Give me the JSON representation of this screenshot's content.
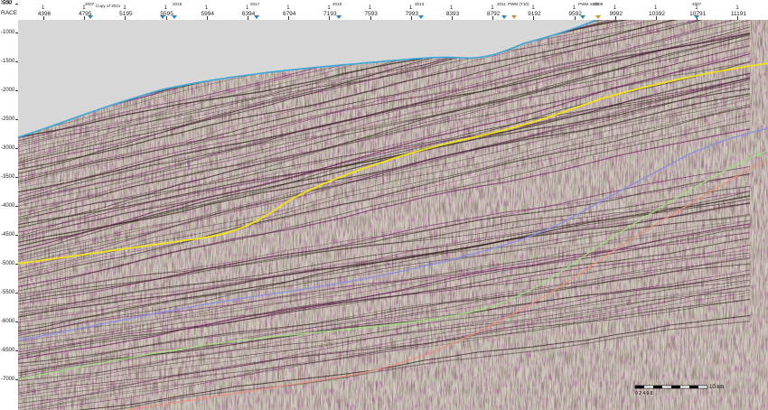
{
  "header": {
    "top_left_label": "SSD",
    "row_label": "RACE",
    "shot_labels": [
      "1",
      "1",
      "1",
      "1",
      "1",
      "1",
      "1",
      "1",
      "1",
      "1",
      "1",
      "1",
      "1",
      "1",
      "1",
      "1",
      "1",
      "1",
      "1"
    ],
    "cdp_numbers": [
      "4396",
      "4795",
      "5195",
      "5595",
      "5994",
      "6394",
      "6794",
      "7193",
      "7593",
      "7993",
      "8393",
      "8792",
      "9192",
      "9592",
      "9992",
      "10392",
      "10791",
      "11191"
    ],
    "well_tags": [
      "2007",
      "Copy of 2021",
      "2019",
      "2017",
      "2015",
      "2013",
      "2011",
      "PWM (T10)",
      "PWM 4400",
      "2009",
      "2007"
    ]
  },
  "y_axis": {
    "labels": [
      "-500",
      "-1000",
      "-1500",
      "-2000",
      "-2500",
      "-3000",
      "-3500",
      "-4000",
      "-4500",
      "-5000",
      "-5500",
      "-6000",
      "-6500",
      "-7000"
    ]
  },
  "scale_bar": {
    "label": "10 km",
    "note": "0 2 4 6 8"
  },
  "colors": {
    "seafloor": "#3aa7d8",
    "horizon_yellow": "#f2e21a",
    "horizon_purple": "#8b8ee0",
    "horizon_green": "#9ee07a",
    "horizon_salmon": "#ef8e7a",
    "water_column": "#d7d7d7",
    "wiggle_peak": "#6b1c5c",
    "wiggle_trough": "#2b1f18"
  }
}
